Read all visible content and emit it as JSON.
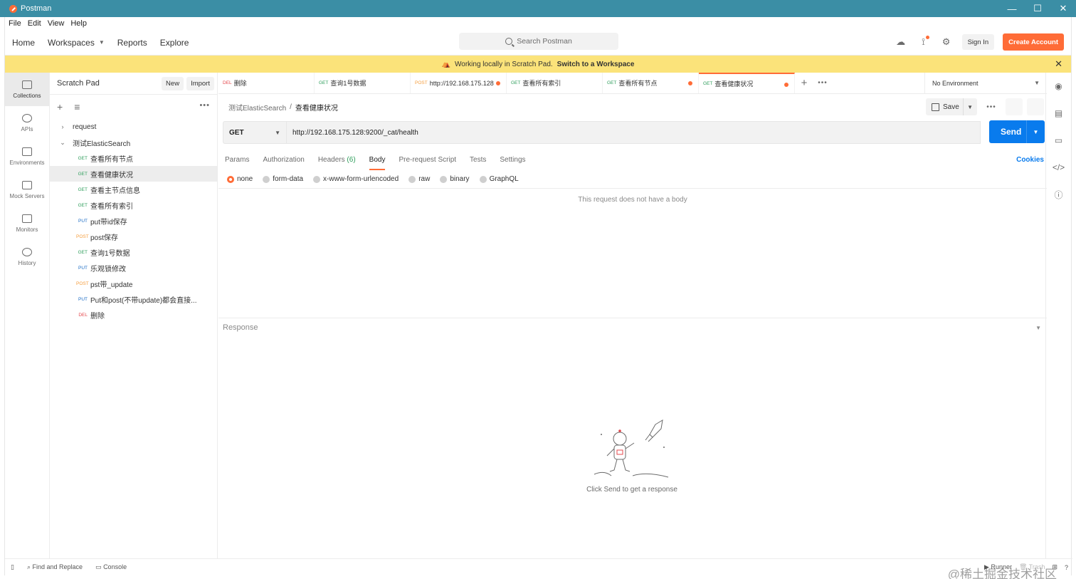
{
  "window": {
    "title": "Postman",
    "controls": [
      "—",
      "☐",
      "✕"
    ]
  },
  "menu": [
    "File",
    "Edit",
    "View",
    "Help"
  ],
  "header": {
    "nav": [
      "Home",
      "Workspaces",
      "Reports",
      "Explore"
    ],
    "search_placeholder": "Search Postman",
    "sign_in": "Sign In",
    "create_account": "Create Account"
  },
  "banner": {
    "text": "Working locally in Scratch Pad.",
    "link": "Switch to a Workspace"
  },
  "rail": [
    {
      "label": "Collections",
      "icon": "collections-icon",
      "active": true
    },
    {
      "label": "APIs",
      "icon": "apis-icon"
    },
    {
      "label": "Environments",
      "icon": "environments-icon"
    },
    {
      "label": "Mock Servers",
      "icon": "mock-servers-icon"
    },
    {
      "label": "Monitors",
      "icon": "monitors-icon"
    },
    {
      "label": "History",
      "icon": "history-icon"
    }
  ],
  "sidebar": {
    "title": "Scratch Pad",
    "new_label": "New",
    "import_label": "Import",
    "collections": [
      {
        "name": "request",
        "expanded": false
      },
      {
        "name": "测试ElasticSearch",
        "expanded": true
      }
    ],
    "requests": [
      {
        "method": "GET",
        "name": "查看所有节点"
      },
      {
        "method": "GET",
        "name": "查看健康状况",
        "selected": true
      },
      {
        "method": "GET",
        "name": "查看主节点信息"
      },
      {
        "method": "GET",
        "name": "查看所有索引"
      },
      {
        "method": "PUT",
        "name": "put带id保存"
      },
      {
        "method": "POST",
        "name": "post保存"
      },
      {
        "method": "GET",
        "name": "查询1号数据"
      },
      {
        "method": "PUT",
        "name": "乐观锁修改"
      },
      {
        "method": "POST",
        "name": "pst带_update"
      },
      {
        "method": "PUT",
        "name": "Put和post(不带update)都会直接..."
      },
      {
        "method": "DEL",
        "name": "删除"
      }
    ]
  },
  "tabs": [
    {
      "method": "DEL",
      "name": "删除",
      "unsaved": false
    },
    {
      "method": "GET",
      "name": "查询1号数据",
      "unsaved": false
    },
    {
      "method": "POST",
      "name": "http://192.168.175.128",
      "unsaved": true
    },
    {
      "method": "GET",
      "name": "查看所有索引",
      "unsaved": false
    },
    {
      "method": "GET",
      "name": "查看所有节点",
      "unsaved": true
    },
    {
      "method": "GET",
      "name": "查看健康状况",
      "unsaved": true,
      "active": true
    }
  ],
  "environment": "No Environment",
  "request": {
    "breadcrumb_parent": "测试ElasticSearch",
    "breadcrumb_sep": "/",
    "breadcrumb_current": "查看健康状况",
    "save_label": "Save",
    "method": "GET",
    "url": "http://192.168.175.128:9200/_cat/health",
    "send_label": "Send",
    "tabs": [
      "Params",
      "Authorization",
      "Headers",
      "Body",
      "Pre-request Script",
      "Tests",
      "Settings"
    ],
    "headers_count": "(6)",
    "active_tab": "Body",
    "cookies_label": "Cookies",
    "body_types": [
      "none",
      "form-data",
      "x-www-form-urlencoded",
      "raw",
      "binary",
      "GraphQL"
    ],
    "selected_body_type": "none",
    "no_body_text": "This request does not have a body"
  },
  "response": {
    "title": "Response",
    "hint": "Click Send to get a response"
  },
  "statusbar": {
    "find_replace": "Find and Replace",
    "console": "Console",
    "runner": "Runner",
    "trash": "Trash"
  },
  "watermark": "@稀土掘金技术社区",
  "colors": {
    "titlebar": "#3b8ea5",
    "accent": "#ff6c37",
    "send": "#097bed",
    "banner": "#fbe37a"
  }
}
